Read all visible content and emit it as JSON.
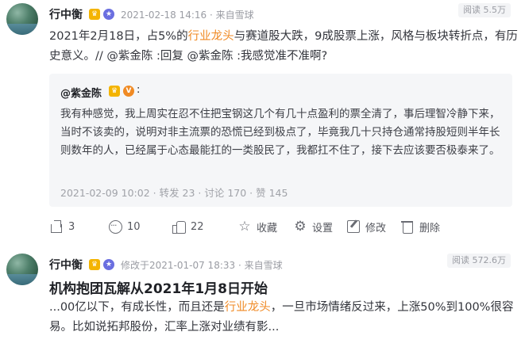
{
  "post1": {
    "author": "行中衡",
    "timestamp": "2021-02-18 14:16",
    "source": "来自雪球",
    "views": "阅读 5.5万",
    "text_before": "2021年2月18日，占5%的",
    "highlight": "行业龙头",
    "text_after": "与赛道股大跌，9成股票上涨，风格与板块转折点，有历史意义。// @紫金陈 :回复 @紫金陈 :我感觉准不准啊?",
    "quote": {
      "author": "@紫金陈",
      "text": "我有种感觉，我上周实在忍不住把宝钢这几个有几十点盈利的票全清了，事后理智冷静下来，当时不该卖的，说明对非主流票的恐慌已经到极点了，毕竟我几十只持仓通常持股短则半年长则数年的人，已经属于心态最能扛的一类股民了，我都扛不住了，接下去应该要否极泰来了。",
      "meta": "2021-02-09 10:02 · 转发 23 · 讨论 170 · 赞 145"
    },
    "actions": {
      "share_count": "3",
      "comment_count": "10",
      "like_count": "22",
      "favorite_label": "收藏",
      "settings_label": "设置",
      "edit_label": "修改",
      "delete_label": "删除"
    }
  },
  "post2": {
    "author": "行中衡",
    "timestamp": "修改于2021-01-07 18:33",
    "source": "来自雪球",
    "views": "阅读 572.6万",
    "title": "机构抱团瓦解从2021年1月8日开始",
    "text_before": "...00亿以下，有成长性，而且还是",
    "highlight": "行业龙头",
    "text_after": "，一旦市场情绪反过来，上涨50%到100%很容易。比如说拓邦股份，汇率上涨对业绩有影..."
  },
  "colors": {
    "highlight": "#f08a24",
    "crown_badge": "#f4b400",
    "star_badge": "#6b6fe0",
    "v_badge": "#f08a24"
  }
}
